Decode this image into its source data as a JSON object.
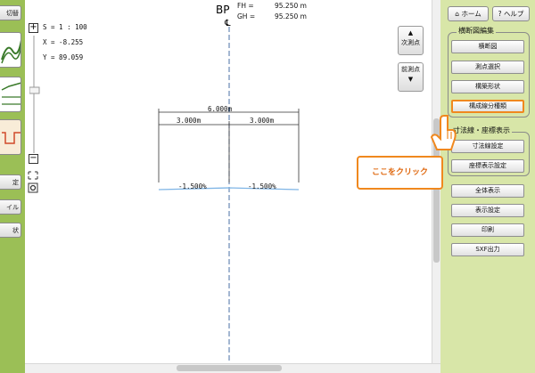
{
  "left_toolbar": {
    "top_button": "切替",
    "buttons": [
      "定",
      "イル",
      "状"
    ]
  },
  "canvas": {
    "scale_text": "S = 1 : 100",
    "x_text": "X = -8.255",
    "y_text": "Y = 89.059",
    "station": "BP",
    "centerline_symbol": "℄",
    "fh_label": "FH =",
    "fh_value": "95.250 m",
    "gh_label": "GH =",
    "gh_value": "95.250 m",
    "next_point": {
      "label": "次測点",
      "arrow": "▲"
    },
    "prev_point": {
      "label": "前測点",
      "arrow": "▼"
    },
    "dimensions": {
      "total": "6.000m",
      "left": "3.000m",
      "right": "3.000m"
    },
    "slopes": {
      "left": "-1.500%",
      "right": "-1.500%"
    },
    "plus_label": "+",
    "minus_label": "−"
  },
  "right_panel": {
    "home": "ホーム",
    "help": "ヘルプ",
    "group1": {
      "title": "横断図編集",
      "buttons": [
        "横断図",
        "測点選択",
        "構築形状",
        "構成線分種類"
      ]
    },
    "group2": {
      "title": "寸法線・座標表示",
      "buttons": [
        "寸法線設定",
        "座標表示設定"
      ]
    },
    "buttons": [
      "全体表示",
      "表示設定",
      "印刷",
      "SXF出力"
    ]
  },
  "callout": {
    "text": "ここをクリック"
  },
  "colors": {
    "accent": "#f0881e",
    "panel": "#d8e6a8",
    "left_strip": "#9bbf56",
    "slope_line": "#7fb5e6",
    "centerline": "#4a6fa5"
  }
}
